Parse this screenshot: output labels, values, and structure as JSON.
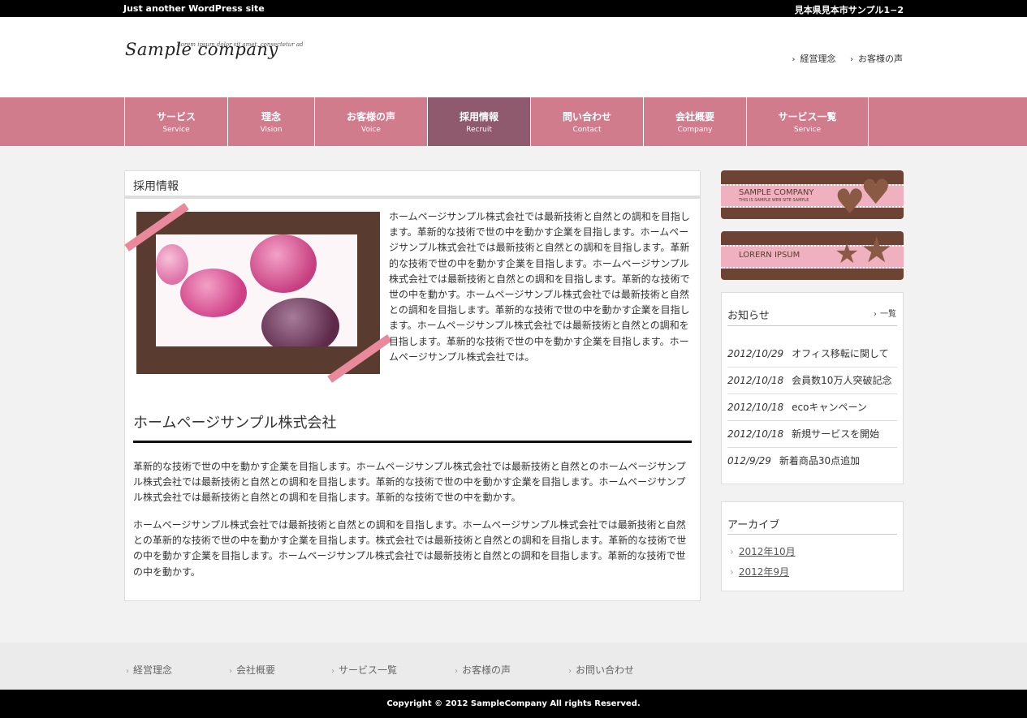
{
  "topbar": {
    "tagline": "Just another WordPress site",
    "address": "見本県見本市サンプル1−2"
  },
  "header": {
    "logo": "Sample company",
    "logo_tagline": "Lorem ipsum dolor sit amet, consectetur ad",
    "links": [
      "経営理念",
      "お客様の声"
    ]
  },
  "nav": [
    {
      "jp": "サービス",
      "en": "Service"
    },
    {
      "jp": "理念",
      "en": "Vision"
    },
    {
      "jp": "お客様の声",
      "en": "Voice"
    },
    {
      "jp": "採用情報",
      "en": "Recruit",
      "active": true
    },
    {
      "jp": "問い合わせ",
      "en": "Contact"
    },
    {
      "jp": "会社概要",
      "en": "Company"
    },
    {
      "jp": "サービス一覧",
      "en": "Service"
    }
  ],
  "main": {
    "title": "採用情報",
    "lead": "ホームページサンプル株式会社では最新技術と自然との調和を目指します。革新的な技術で世の中を動かす企業を目指します。ホームページサンプル株式会社では最新技術と自然との調和を目指します。革新的な技術で世の中を動かす企業を目指します。ホームページサンプル株式会社では最新技術と自然との調和を目指します。革新的な技術で世の中を動かす。ホームページサンプル株式会社では最新技術と自然との調和を目指します。革新的な技術で世の中を動かす企業を目指します。ホームページサンプル株式会社では最新技術と自然との調和を目指します。革新的な技術で世の中を動かす企業を目指します。ホームページサンプル株式会社では。",
    "heading": "ホームページサンプル株式会社",
    "para1": "革新的な技術で世の中を動かす企業を目指します。ホームページサンプル株式会社では最新技術と自然とのホームページサンプル株式会社では最新技術と自然との調和を目指します。革新的な技術で世の中を動かす企業を目指します。ホームページサンプル株式会社では最新技術と自然との調和を目指します。革新的な技術で世の中を動かす。",
    "para2": "ホームページサンプル株式会社では最新技術と自然との調和を目指します。ホームページサンプル株式会社では最新技術と自然との革新的な技術で世の中を動かす企業を目指します。株式会社では最新技術と自然との調和を目指します。革新的な技術で世の中を動かす企業を目指します。ホームページサンプル株式会社では最新技術と自然との調和を目指します。革新的な技術で世の中を動かす。"
  },
  "sidebar": {
    "banner1": {
      "title": "SAMPLE COMPANY",
      "sub": "THIS IS SAMPLE WEB SITE SAMPLE"
    },
    "banner2": {
      "title": "LORERN IPSUM"
    },
    "news": {
      "title": "お知らせ",
      "more": "一覧",
      "items": [
        {
          "date": "2012/10/29",
          "text": "オフィス移転に関して"
        },
        {
          "date": "2012/10/18",
          "text": "会員数10万人突破記念"
        },
        {
          "date": "2012/10/18",
          "text": "ecoキャンペーン"
        },
        {
          "date": "2012/10/18",
          "text": "新規サービスを開始"
        },
        {
          "date": "012/9/29",
          "text": "新着商品30点追加"
        }
      ]
    },
    "archive": {
      "title": "アーカイブ",
      "items": [
        "2012年10月",
        "2012年9月"
      ]
    }
  },
  "footer": {
    "links": [
      "経営理念",
      "会社概要",
      "サービス一覧",
      "お客様の声",
      "お問い合わせ"
    ],
    "copyright": "Copyright © 2012 SampleCompany All rights Reserved."
  },
  "colors": {
    "nav": "#d07c8c",
    "nav_active": "#8f5a6e",
    "banner_brown": "#6d4434",
    "banner_pink": "#efb1bf"
  }
}
